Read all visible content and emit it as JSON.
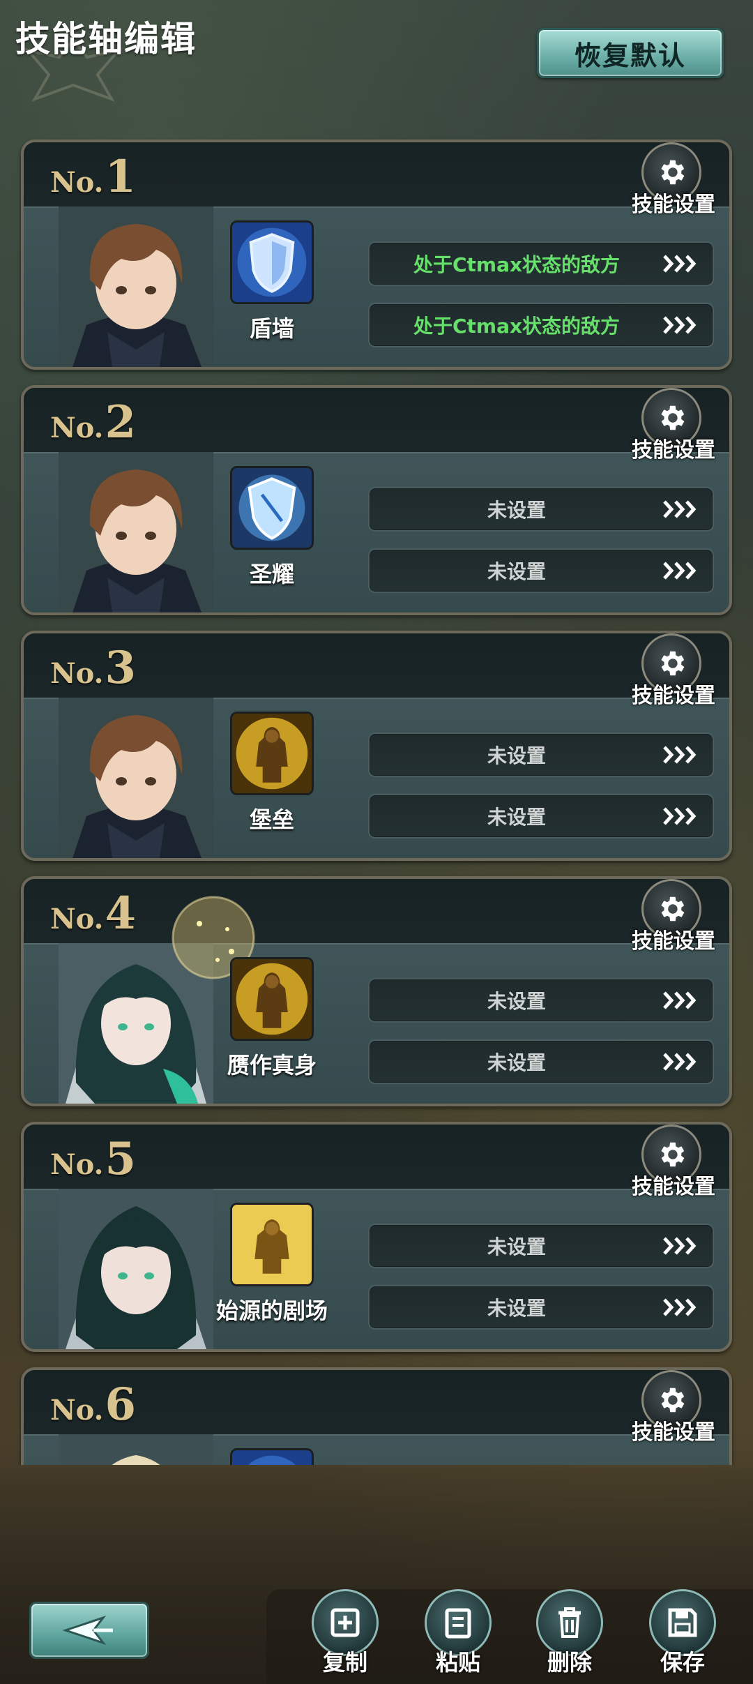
{
  "header": {
    "title": "技能轴编辑",
    "restore_default_label": "恢复默认"
  },
  "cards": [
    {
      "no_prefix": "No.",
      "number": "1",
      "settings_label": "技能设置",
      "skill_name": "盾墙",
      "skill_icon": "shield-icon",
      "portrait": "brown-hair-character",
      "slots": [
        {
          "text": "处于Ctmax状态的敌方",
          "set": true
        },
        {
          "text": "处于Ctmax状态的敌方",
          "set": true
        }
      ]
    },
    {
      "no_prefix": "No.",
      "number": "2",
      "settings_label": "技能设置",
      "skill_name": "圣耀",
      "skill_icon": "shield-icon",
      "portrait": "brown-hair-character",
      "slots": [
        {
          "text": "未设置",
          "set": false
        },
        {
          "text": "未设置",
          "set": false
        }
      ]
    },
    {
      "no_prefix": "No.",
      "number": "3",
      "settings_label": "技能设置",
      "skill_name": "堡垒",
      "skill_icon": "golden-knight-icon",
      "portrait": "brown-hair-character",
      "slots": [
        {
          "text": "未设置",
          "set": false
        },
        {
          "text": "未设置",
          "set": false
        }
      ]
    },
    {
      "no_prefix": "No.",
      "number": "4",
      "settings_label": "技能设置",
      "skill_name": "赝作真身",
      "skill_icon": "golden-knight-icon",
      "portrait": "green-hair-character",
      "slots": [
        {
          "text": "未设置",
          "set": false
        },
        {
          "text": "未设置",
          "set": false
        }
      ]
    },
    {
      "no_prefix": "No.",
      "number": "5",
      "settings_label": "技能设置",
      "skill_name": "始源的剧场",
      "skill_icon": "golden-knight-icon",
      "portrait": "green-hair-character",
      "slots": [
        {
          "text": "未设置",
          "set": false
        },
        {
          "text": "未设置",
          "set": false
        }
      ]
    },
    {
      "no_prefix": "No.",
      "number": "6",
      "settings_label": "技能设置",
      "skill_name": "",
      "skill_icon": "shield-icon",
      "portrait": "blonde-character",
      "slots": [
        {
          "text": "",
          "set": false
        },
        {
          "text": "",
          "set": false
        }
      ]
    }
  ],
  "toolbar": {
    "copy_label": "复制",
    "paste_label": "粘贴",
    "delete_label": "删除",
    "save_label": "保存"
  },
  "colors": {
    "accent_teal": "#6fb2ab",
    "set_condition_green": "#67e06b",
    "number_gold": "#d8c28d"
  }
}
